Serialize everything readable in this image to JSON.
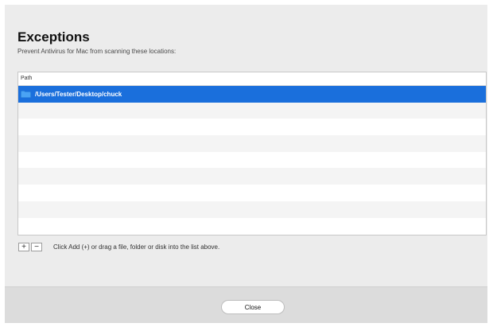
{
  "dialog": {
    "title": "Exceptions",
    "subtitle": "Prevent Antivirus for Mac from scanning these locations:"
  },
  "table": {
    "column_header": "Path",
    "rows": [
      {
        "icon": "folder-icon",
        "path": "/Users/Tester/Desktop/chuck",
        "selected": true
      }
    ]
  },
  "controls": {
    "add_label": "+",
    "remove_label": "−",
    "hint": "Click Add (+) or drag a file, folder or disk into the list above."
  },
  "footer": {
    "close_label": "Close"
  },
  "colors": {
    "selection": "#1a6fdc",
    "folder": "#4aa3f4"
  }
}
